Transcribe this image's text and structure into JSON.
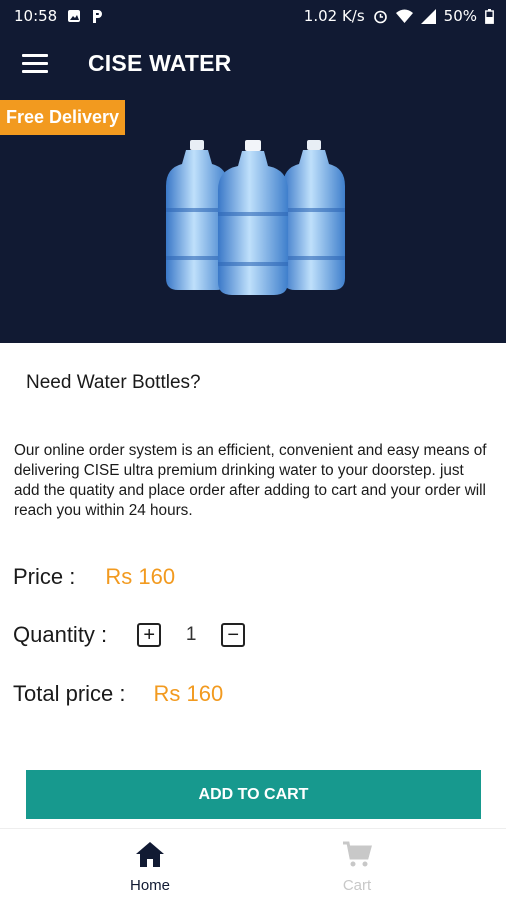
{
  "status_bar": {
    "time": "10:58",
    "speed": "1.02 K/s",
    "battery": "50%"
  },
  "app_bar": {
    "title": "CISE WATER"
  },
  "hero": {
    "badge": "Free Delivery"
  },
  "product": {
    "heading": "Need Water Bottles?",
    "description": "Our online order system is an efficient, convenient and easy means of delivering CISE ultra premium drinking water to your doorstep. just add the quatity and place order after adding to cart and your order will reach you within 24 hours.",
    "price_label": "Price :",
    "price_value": "Rs 160",
    "quantity_label": "Quantity :",
    "quantity_value": "1",
    "total_label": "Total price :",
    "total_value": "Rs 160"
  },
  "actions": {
    "add_to_cart": "ADD TO CART"
  },
  "bottom_nav": {
    "home": "Home",
    "cart": "Cart"
  },
  "colors": {
    "header": "#111a33",
    "accent": "#f29a1f",
    "button": "#17998e"
  }
}
